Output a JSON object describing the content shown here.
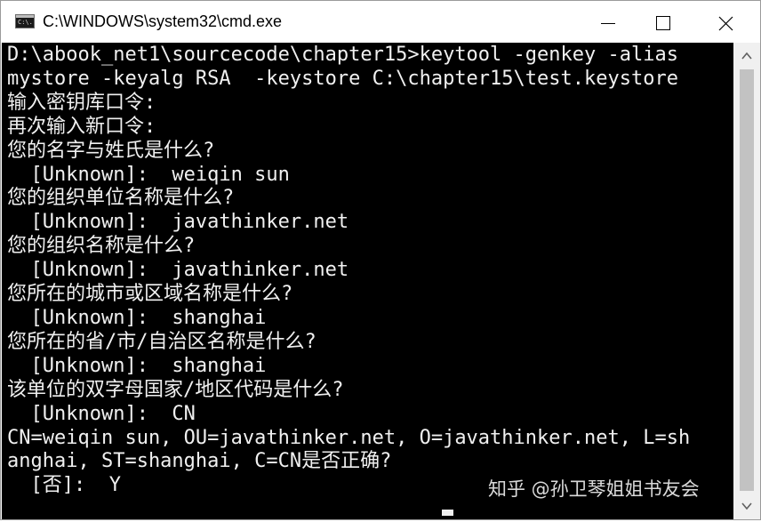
{
  "window": {
    "title": "C:\\WINDOWS\\system32\\cmd.exe",
    "icon": "cmd-icon",
    "icon_text": "C:\\."
  },
  "titlebar_buttons": {
    "minimize": "minimize-icon",
    "maximize": "maximize-icon",
    "close": "close-icon"
  },
  "console": {
    "lines": [
      "D:\\abook_net1\\sourcecode\\chapter15>keytool -genkey -alias",
      "mystore -keyalg RSA  -keystore C:\\chapter15\\test.keystore",
      "输入密钥库口令:",
      "再次输入新口令:",
      "您的名字与姓氏是什么?",
      "  [Unknown]:  weiqin sun",
      "您的组织单位名称是什么?",
      "  [Unknown]:  javathinker.net",
      "您的组织名称是什么?",
      "  [Unknown]:  javathinker.net",
      "您所在的城市或区域名称是什么?",
      "  [Unknown]:  shanghai",
      "您所在的省/市/自治区名称是什么?",
      "  [Unknown]:  shanghai",
      "该单位的双字母国家/地区代码是什么?",
      "  [Unknown]:  CN",
      "CN=weiqin sun, OU=javathinker.net, O=javathinker.net, L=sh",
      "anghai, ST=shanghai, C=CN是否正确?",
      "  [否]:  Y"
    ]
  },
  "watermark": "知乎 @孙卫琴姐姐书友会",
  "colors": {
    "console_bg": "#000000",
    "console_fg": "#f0f0f0",
    "titlebar_bg": "#ffffff",
    "scrollbar_bg": "#f0f0f0",
    "scrollbar_thumb": "#c2c2c2"
  }
}
